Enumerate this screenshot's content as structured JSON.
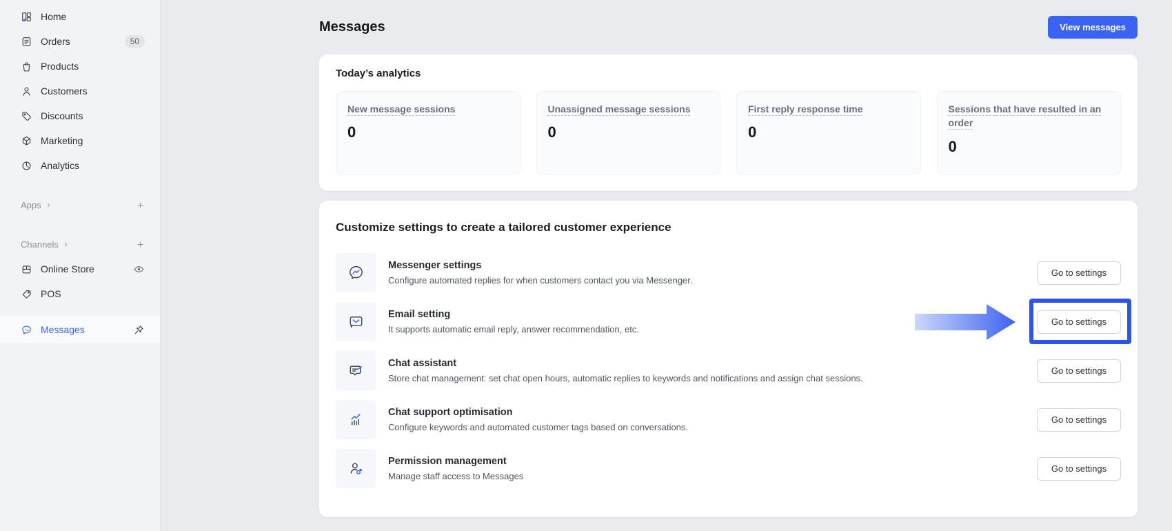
{
  "sidebar": {
    "items": [
      {
        "label": "Home",
        "icon": "home-icon"
      },
      {
        "label": "Orders",
        "icon": "orders-icon",
        "badge": "50"
      },
      {
        "label": "Products",
        "icon": "products-icon"
      },
      {
        "label": "Customers",
        "icon": "customers-icon"
      },
      {
        "label": "Discounts",
        "icon": "discounts-icon"
      },
      {
        "label": "Marketing",
        "icon": "marketing-icon"
      },
      {
        "label": "Analytics",
        "icon": "analytics-icon"
      }
    ],
    "sections": [
      {
        "label": "Apps",
        "add_icon": "plus-icon"
      },
      {
        "label": "Channels",
        "add_icon": "plus-icon"
      }
    ],
    "channels": [
      {
        "label": "Online Store",
        "icon": "store-icon",
        "trailing_icon": "eye-icon"
      },
      {
        "label": "POS",
        "icon": "pos-icon"
      }
    ],
    "messages_item": {
      "label": "Messages",
      "icon": "chat-bubble-icon",
      "trailing_icon": "pin-icon"
    }
  },
  "header": {
    "title": "Messages",
    "view_messages_label": "View messages"
  },
  "analytics": {
    "title": "Today’s analytics",
    "stats": [
      {
        "label": "New message sessions",
        "value": "0"
      },
      {
        "label": "Unassigned message sessions",
        "value": "0"
      },
      {
        "label": "First reply response time",
        "value": "0"
      },
      {
        "label": "Sessions that have resulted in an order",
        "value": "0"
      }
    ]
  },
  "settings": {
    "title": "Customize settings to create a tailored customer experience",
    "button_label": "Go to settings",
    "rows": [
      {
        "title": "Messenger settings",
        "icon": "messenger-icon",
        "description": "Configure automated replies for when customers contact you via Messenger."
      },
      {
        "title": "Email setting",
        "icon": "email-icon",
        "description": "It supports automatic email reply, answer recommendation, etc.",
        "highlighted": true
      },
      {
        "title": "Chat assistant",
        "icon": "chat-assistant-icon",
        "description": "Store chat management: set chat open hours, automatic replies to keywords and notifications and assign chat sessions."
      },
      {
        "title": "Chat support optimisation",
        "icon": "chart-icon",
        "description": "Configure keywords and automated customer tags based on conversations."
      },
      {
        "title": "Permission management",
        "icon": "permission-icon",
        "description": "Manage staff access to Messages"
      }
    ]
  },
  "colors": {
    "accent": "#3b63f3",
    "highlight_border": "#2b55e8",
    "active_item_text": "#3d63ed",
    "page_background": "#e9ebee",
    "sidebar_background": "#f2f3f5"
  }
}
